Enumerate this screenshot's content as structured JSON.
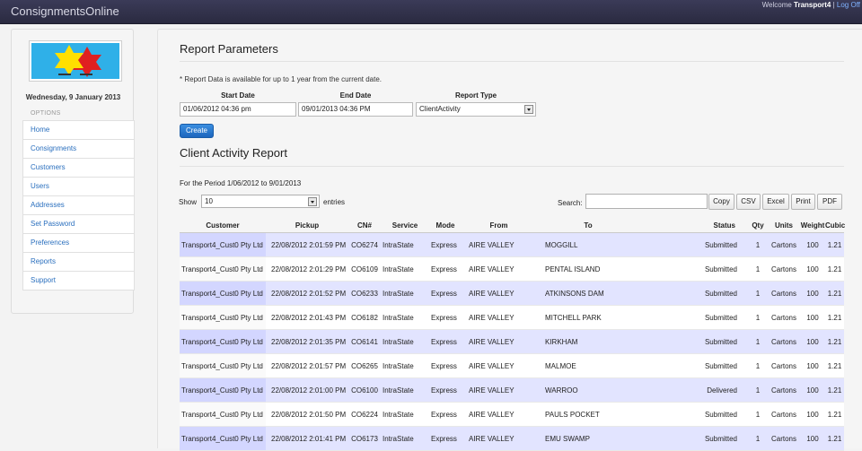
{
  "app": {
    "title": "ConsignmentsOnline"
  },
  "header": {
    "welcome_prefix": "Welcome ",
    "user": "Transport4",
    "separator": " | ",
    "logout": "Log Off"
  },
  "sidebar": {
    "date": "Wednesday, 9 January 2013",
    "options_label": "OPTIONS",
    "items": [
      {
        "label": "Home"
      },
      {
        "label": "Consignments"
      },
      {
        "label": "Customers"
      },
      {
        "label": "Users"
      },
      {
        "label": "Addresses"
      },
      {
        "label": "Set Password"
      },
      {
        "label": "Preferences"
      },
      {
        "label": "Reports"
      },
      {
        "label": "Support"
      }
    ]
  },
  "params": {
    "heading": "Report Parameters",
    "note": "* Report Data is available for up to 1 year from the current date.",
    "start_label": "Start Date",
    "start_value": "01/06/2012 04:36 pm",
    "end_label": "End Date",
    "end_value": "09/01/2013 04:36 PM",
    "type_label": "Report Type",
    "type_value": "ClientActivity",
    "create_label": "Create"
  },
  "report": {
    "heading": "Client Activity Report",
    "period": "For the Period 1/06/2012 to 9/01/2013",
    "show_label": "Show",
    "show_value": "10",
    "entries_label": "entries",
    "search_label": "Search:",
    "buttons": [
      "Copy",
      "CSV",
      "Excel",
      "Print",
      "PDF"
    ],
    "columns": [
      "Customer",
      "Pickup",
      "CN#",
      "Service",
      "Mode",
      "From",
      "To",
      "Status",
      "Qty",
      "Units",
      "Weight",
      "Cubic"
    ],
    "rows": [
      [
        "Transport4_Cust0 Pty Ltd",
        "22/08/2012 2:01:59 PM",
        "CO6274",
        "IntraState",
        "Express",
        "AIRE VALLEY",
        "MOGGILL",
        "Submitted",
        "1",
        "Cartons",
        "100",
        "1.21"
      ],
      [
        "Transport4_Cust0 Pty Ltd",
        "22/08/2012 2:01:29 PM",
        "CO6109",
        "IntraState",
        "Express",
        "AIRE VALLEY",
        "PENTAL ISLAND",
        "Submitted",
        "1",
        "Cartons",
        "100",
        "1.21"
      ],
      [
        "Transport4_Cust0 Pty Ltd",
        "22/08/2012 2:01:52 PM",
        "CO6233",
        "IntraState",
        "Express",
        "AIRE VALLEY",
        "ATKINSONS DAM",
        "Submitted",
        "1",
        "Cartons",
        "100",
        "1.21"
      ],
      [
        "Transport4_Cust0 Pty Ltd",
        "22/08/2012 2:01:43 PM",
        "CO6182",
        "IntraState",
        "Express",
        "AIRE VALLEY",
        "MITCHELL PARK",
        "Submitted",
        "1",
        "Cartons",
        "100",
        "1.21"
      ],
      [
        "Transport4_Cust0 Pty Ltd",
        "22/08/2012 2:01:35 PM",
        "CO6141",
        "IntraState",
        "Express",
        "AIRE VALLEY",
        "KIRKHAM",
        "Submitted",
        "1",
        "Cartons",
        "100",
        "1.21"
      ],
      [
        "Transport4_Cust0 Pty Ltd",
        "22/08/2012 2:01:57 PM",
        "CO6265",
        "IntraState",
        "Express",
        "AIRE VALLEY",
        "MALMOE",
        "Submitted",
        "1",
        "Cartons",
        "100",
        "1.21"
      ],
      [
        "Transport4_Cust0 Pty Ltd",
        "22/08/2012 2:01:00 PM",
        "CO6100",
        "IntraState",
        "Express",
        "AIRE VALLEY",
        "WARROO",
        "Delivered",
        "1",
        "Cartons",
        "100",
        "1.21"
      ],
      [
        "Transport4_Cust0 Pty Ltd",
        "22/08/2012 2:01:50 PM",
        "CO6224",
        "IntraState",
        "Express",
        "AIRE VALLEY",
        "PAULS POCKET",
        "Submitted",
        "1",
        "Cartons",
        "100",
        "1.21"
      ],
      [
        "Transport4_Cust0 Pty Ltd",
        "22/08/2012 2:01:41 PM",
        "CO6173",
        "IntraState",
        "Express",
        "AIRE VALLEY",
        "EMU SWAMP",
        "Submitted",
        "1",
        "Cartons",
        "100",
        "1.21"
      ]
    ]
  },
  "colors": {
    "topbar": "#2e2e47",
    "link": "#2a6fbe",
    "create_button": "#1d66bd",
    "row_odd": "#e2e4ff",
    "row_sorted": "#d3d6ff",
    "logo_background": "#2fb0e8",
    "logo_star_red": "#e02020",
    "logo_star_yellow": "#ffe000"
  },
  "icons": {
    "select": "dropdown-arrow-icon",
    "logo": "star-logo-icon"
  }
}
